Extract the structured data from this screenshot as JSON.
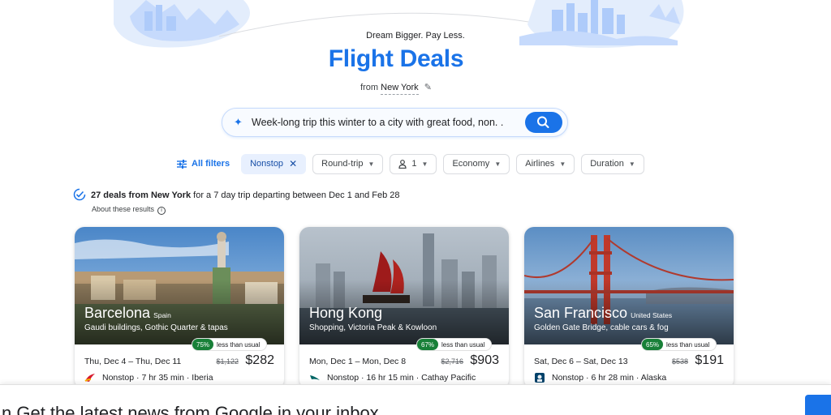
{
  "header": {
    "tagline": "Dream Bigger. Pay Less.",
    "title": "Flight Deals",
    "from_prefix": "from",
    "from_city": "New York"
  },
  "search": {
    "query": "Week-long trip this winter to a city with great food, non. ."
  },
  "filters": {
    "all_filters": "All filters",
    "nonstop": "Nonstop",
    "trip_type": "Round-trip",
    "passengers": "1",
    "cabin": "Economy",
    "airlines": "Airlines",
    "duration": "Duration"
  },
  "summary": {
    "count_text": "27 deals from New York",
    "rest_text": " for a 7 day trip departing between Dec 1 and Feb 28",
    "about": "About these results"
  },
  "deals": [
    {
      "city": "Barcelona",
      "country": "Spain",
      "description": "Gaudi buildings, Gothic Quarter & tapas",
      "percent": "75%",
      "less_than_usual": "less than usual",
      "dates": "Thu, Dec 4 – Thu, Dec 11",
      "old_price": "$1,122",
      "price": "$282",
      "flight": "Nonstop · 7 hr 35 min · Iberia"
    },
    {
      "city": "Hong Kong",
      "country": "",
      "description": "Shopping, Victoria Peak & Kowloon",
      "percent": "67%",
      "less_than_usual": "less than usual",
      "dates": "Mon, Dec 1 – Mon, Dec 8",
      "old_price": "$2,716",
      "price": "$903",
      "flight": "Nonstop · 16 hr 15 min · Cathay Pacific"
    },
    {
      "city": "San Francisco",
      "country": "United States",
      "description": "Golden Gate Bridge, cable cars & fog",
      "percent": "65%",
      "less_than_usual": "less than usual",
      "dates": "Sat, Dec 6 – Sat, Dec 13",
      "old_price": "$538",
      "price": "$191",
      "flight": "Nonstop · 6 hr 28 min · Alaska"
    }
  ],
  "banner": {
    "message": "n  Get the latest news from Google in your inbox"
  },
  "colors": {
    "accent": "#1a73e8",
    "deal_green": "#188038"
  },
  "icons": [
    "pencil-icon",
    "sparkle-icon",
    "search-icon",
    "filter-sliders-icon",
    "close-icon",
    "person-icon",
    "chevron-down-icon",
    "verified-check-icon",
    "info-icon",
    "iberia-icon",
    "cathay-pacific-icon",
    "alaska-icon"
  ]
}
